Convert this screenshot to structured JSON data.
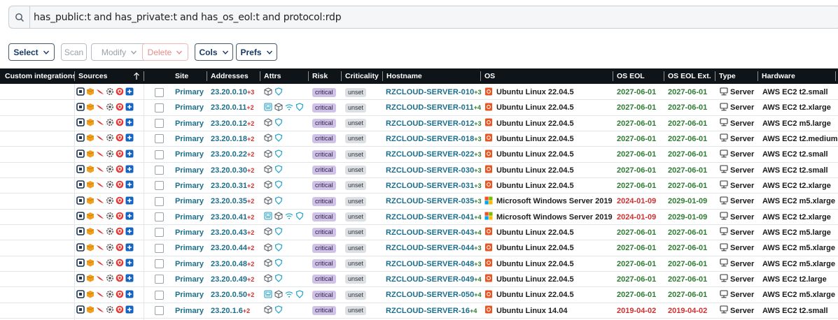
{
  "search": {
    "query": "has_public:t and has_private:t and has_os_eol:t and protocol:rdp"
  },
  "toolbar": {
    "select_label": "Select",
    "scan_label": "Scan",
    "modify_label": "Modify",
    "delete_label": "Delete",
    "cols_label": "Cols",
    "prefs_label": "Prefs"
  },
  "columns": {
    "custom_integrations": "Custom integrations",
    "sources": "Sources",
    "site": "Site",
    "addresses": "Addresses",
    "attrs": "Attrs",
    "risk": "Risk",
    "criticality": "Criticality",
    "hostname": "Hostname",
    "os": "OS",
    "os_eol": "OS EOL",
    "os_eol_ext": "OS EOL Ext.",
    "type": "Type",
    "hardware": "Hardware"
  },
  "colors": {
    "header_bg": "#0f1418",
    "link": "#1b6f8c",
    "eol_ok": "#2e7d32",
    "eol_bad": "#d32f2f"
  },
  "rows": [
    {
      "site": "Primary",
      "address": "23.20.0.10",
      "addr_more": "+3",
      "attrs": [
        "cube",
        "shield"
      ],
      "risk": "critical",
      "criticality": "unset",
      "hostname": "RZCLOUD-SERVER-010",
      "host_more": "+3",
      "os_icon": "ubuntu-icon",
      "os": "Ubuntu Linux 22.04.5",
      "os_eol": "2027-06-01",
      "os_eol_ext": "2027-06-01",
      "eol_status": "ok",
      "eol_ext_status": "ok",
      "type": "Server",
      "hardware": "AWS EC2 t2.small"
    },
    {
      "site": "Primary",
      "address": "23.20.0.11",
      "addr_more": "+2",
      "attrs": [
        "monitor",
        "cube",
        "wifi",
        "shield"
      ],
      "risk": "critical",
      "criticality": "unset",
      "hostname": "RZCLOUD-SERVER-011",
      "host_more": "+4",
      "os_icon": "ubuntu-icon",
      "os": "Ubuntu Linux 22.04.5",
      "os_eol": "2027-06-01",
      "os_eol_ext": "2027-06-01",
      "eol_status": "ok",
      "eol_ext_status": "ok",
      "type": "Server",
      "hardware": "AWS EC2 t2.xlarge"
    },
    {
      "site": "Primary",
      "address": "23.20.0.12",
      "addr_more": "+2",
      "attrs": [
        "cube",
        "shield"
      ],
      "risk": "critical",
      "criticality": "unset",
      "hostname": "RZCLOUD-SERVER-012",
      "host_more": "+3",
      "os_icon": "ubuntu-icon",
      "os": "Ubuntu Linux 22.04.5",
      "os_eol": "2027-06-01",
      "os_eol_ext": "2027-06-01",
      "eol_status": "ok",
      "eol_ext_status": "ok",
      "type": "Server",
      "hardware": "AWS EC2 m5.large"
    },
    {
      "site": "Primary",
      "address": "23.20.0.18",
      "addr_more": "+2",
      "attrs": [
        "cube",
        "shield"
      ],
      "risk": "critical",
      "criticality": "unset",
      "hostname": "RZCLOUD-SERVER-018",
      "host_more": "+3",
      "os_icon": "ubuntu-icon",
      "os": "Ubuntu Linux 22.04.5",
      "os_eol": "2027-06-01",
      "os_eol_ext": "2027-06-01",
      "eol_status": "ok",
      "eol_ext_status": "ok",
      "type": "Server",
      "hardware": "AWS EC2 t2.medium"
    },
    {
      "site": "Primary",
      "address": "23.20.0.22",
      "addr_more": "+2",
      "attrs": [
        "cube",
        "shield"
      ],
      "risk": "critical",
      "criticality": "unset",
      "hostname": "RZCLOUD-SERVER-022",
      "host_more": "+3",
      "os_icon": "ubuntu-icon",
      "os": "Ubuntu Linux 22.04.5",
      "os_eol": "2027-06-01",
      "os_eol_ext": "2027-06-01",
      "eol_status": "ok",
      "eol_ext_status": "ok",
      "type": "Server",
      "hardware": "AWS EC2 t2.small"
    },
    {
      "site": "Primary",
      "address": "23.20.0.30",
      "addr_more": "+2",
      "attrs": [
        "cube",
        "shield"
      ],
      "risk": "critical",
      "criticality": "unset",
      "hostname": "RZCLOUD-SERVER-030",
      "host_more": "+3",
      "os_icon": "ubuntu-icon",
      "os": "Ubuntu Linux 22.04.5",
      "os_eol": "2027-06-01",
      "os_eol_ext": "2027-06-01",
      "eol_status": "ok",
      "eol_ext_status": "ok",
      "type": "Server",
      "hardware": "AWS EC2 t2.small"
    },
    {
      "site": "Primary",
      "address": "23.20.0.31",
      "addr_more": "+2",
      "attrs": [
        "cube",
        "shield"
      ],
      "risk": "critical",
      "criticality": "unset",
      "hostname": "RZCLOUD-SERVER-031",
      "host_more": "+3",
      "os_icon": "ubuntu-icon",
      "os": "Ubuntu Linux 22.04.5",
      "os_eol": "2027-06-01",
      "os_eol_ext": "2027-06-01",
      "eol_status": "ok",
      "eol_ext_status": "ok",
      "type": "Server",
      "hardware": "AWS EC2 t2.xlarge"
    },
    {
      "site": "Primary",
      "address": "23.20.0.35",
      "addr_more": "+2",
      "attrs": [
        "cube",
        "shield"
      ],
      "risk": "critical",
      "criticality": "unset",
      "hostname": "RZCLOUD-SERVER-035",
      "host_more": "+3",
      "os_icon": "windows-icon",
      "os": "Microsoft Windows Server 2019",
      "os_eol": "2024-01-09",
      "os_eol_ext": "2029-01-09",
      "eol_status": "bad",
      "eol_ext_status": "ok",
      "type": "Server",
      "hardware": "AWS EC2 m5.xlarge"
    },
    {
      "site": "Primary",
      "address": "23.20.0.41",
      "addr_more": "+2",
      "attrs": [
        "monitor",
        "cube",
        "wifi",
        "shield"
      ],
      "risk": "critical",
      "criticality": "unset",
      "hostname": "RZCLOUD-SERVER-041",
      "host_more": "+4",
      "os_icon": "windows-icon",
      "os": "Microsoft Windows Server 2019",
      "os_eol": "2024-01-09",
      "os_eol_ext": "2029-01-09",
      "eol_status": "bad",
      "eol_ext_status": "ok",
      "type": "Server",
      "hardware": "AWS EC2 t2.xlarge"
    },
    {
      "site": "Primary",
      "address": "23.20.0.43",
      "addr_more": "+2",
      "attrs": [
        "cube",
        "shield"
      ],
      "risk": "critical",
      "criticality": "unset",
      "hostname": "RZCLOUD-SERVER-043",
      "host_more": "+4",
      "os_icon": "ubuntu-icon",
      "os": "Ubuntu Linux 22.04.5",
      "os_eol": "2027-06-01",
      "os_eol_ext": "2027-06-01",
      "eol_status": "ok",
      "eol_ext_status": "ok",
      "type": "Server",
      "hardware": "AWS EC2 m5.large"
    },
    {
      "site": "Primary",
      "address": "23.20.0.44",
      "addr_more": "+2",
      "attrs": [
        "cube",
        "shield"
      ],
      "risk": "critical",
      "criticality": "unset",
      "hostname": "RZCLOUD-SERVER-044",
      "host_more": "+3",
      "os_icon": "ubuntu-icon",
      "os": "Ubuntu Linux 22.04.5",
      "os_eol": "2027-06-01",
      "os_eol_ext": "2027-06-01",
      "eol_status": "ok",
      "eol_ext_status": "ok",
      "type": "Server",
      "hardware": "AWS EC2 m5.xlarge"
    },
    {
      "site": "Primary",
      "address": "23.20.0.48",
      "addr_more": "+2",
      "attrs": [
        "cube",
        "shield"
      ],
      "risk": "critical",
      "criticality": "unset",
      "hostname": "RZCLOUD-SERVER-048",
      "host_more": "+3",
      "os_icon": "ubuntu-icon",
      "os": "Ubuntu Linux 22.04.5",
      "os_eol": "2027-06-01",
      "os_eol_ext": "2027-06-01",
      "eol_status": "ok",
      "eol_ext_status": "ok",
      "type": "Server",
      "hardware": "AWS EC2 m5.xlarge"
    },
    {
      "site": "Primary",
      "address": "23.20.0.49",
      "addr_more": "+2",
      "attrs": [
        "cube",
        "shield"
      ],
      "risk": "critical",
      "criticality": "unset",
      "hostname": "RZCLOUD-SERVER-049",
      "host_more": "+4",
      "os_icon": "ubuntu-icon",
      "os": "Ubuntu Linux 22.04.5",
      "os_eol": "2027-06-01",
      "os_eol_ext": "2027-06-01",
      "eol_status": "ok",
      "eol_ext_status": "ok",
      "type": "Server",
      "hardware": "AWS EC2 t2.large"
    },
    {
      "site": "Primary",
      "address": "23.20.0.50",
      "addr_more": "+2",
      "attrs": [
        "monitor",
        "cube",
        "wifi",
        "shield"
      ],
      "risk": "critical",
      "criticality": "unset",
      "hostname": "RZCLOUD-SERVER-050",
      "host_more": "+4",
      "os_icon": "ubuntu-icon",
      "os": "Ubuntu Linux 22.04.5",
      "os_eol": "2027-06-01",
      "os_eol_ext": "2027-06-01",
      "eol_status": "ok",
      "eol_ext_status": "ok",
      "type": "Server",
      "hardware": "AWS EC2 m5.xlarge"
    },
    {
      "site": "Primary",
      "address": "23.20.1.6",
      "addr_more": "+2",
      "attrs": [
        "cube",
        "shield"
      ],
      "risk": "critical",
      "criticality": "unset",
      "hostname": "RZCLOUD-SERVER-16",
      "host_more": "+4",
      "os_icon": "ubuntu-icon",
      "os": "Ubuntu Linux 14.04",
      "os_eol": "2019-04-02",
      "os_eol_ext": "2019-04-02",
      "eol_status": "bad",
      "eol_ext_status": "bad",
      "type": "Server",
      "hardware": "AWS EC2 t2.small"
    }
  ]
}
